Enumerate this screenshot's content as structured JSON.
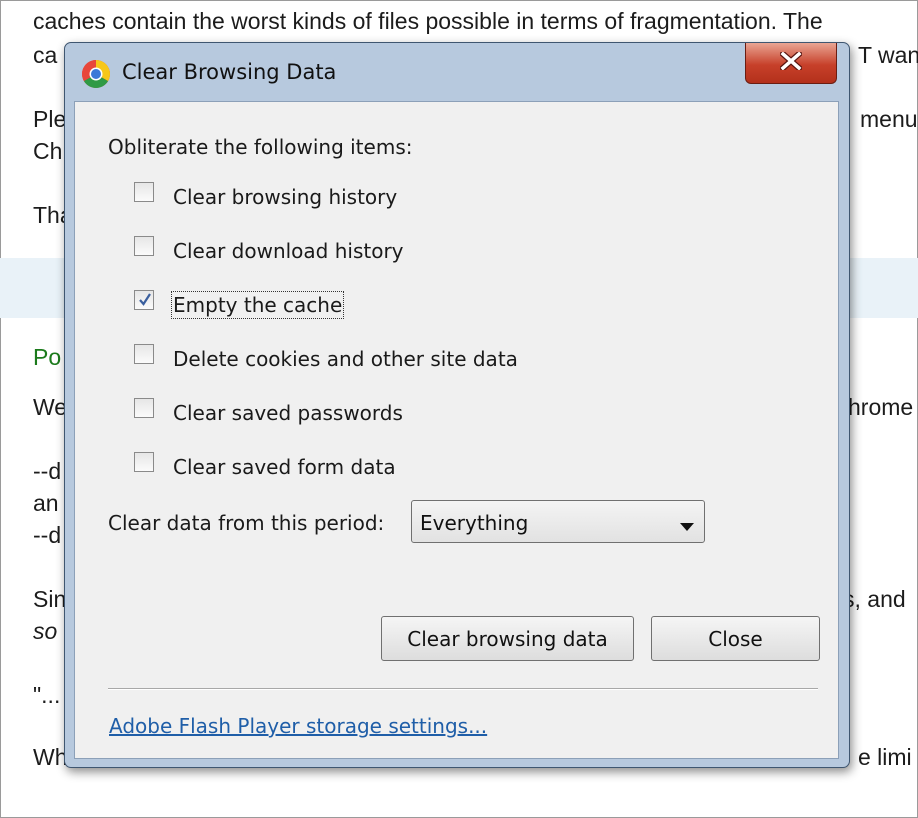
{
  "background": {
    "lines": [
      "caches contain the worst kinds of files possible in terms of fragmentation. The",
      "ca",
      "T want",
      "Ple",
      "menu",
      "Ch",
      "Tha",
      "Po",
      "We",
      "hrome",
      "--d",
      "an",
      "--d",
      "Sin",
      "s, and",
      "so",
      "\"...",
      "Wh",
      "e limi"
    ]
  },
  "dialog": {
    "title": "Clear Browsing Data",
    "close_icon": "close-icon",
    "app_icon": "chrome-icon",
    "heading": "Obliterate the following items:",
    "options": [
      {
        "label": "Clear browsing history",
        "checked": false
      },
      {
        "label": "Clear download history",
        "checked": false
      },
      {
        "label": "Empty the cache",
        "checked": true
      },
      {
        "label": "Delete cookies and other site data",
        "checked": false
      },
      {
        "label": "Clear saved passwords",
        "checked": false
      },
      {
        "label": "Clear saved form data",
        "checked": false
      }
    ],
    "period_label": "Clear data from this period:",
    "period_value": "Everything",
    "clear_button": "Clear browsing data",
    "close_button": "Close",
    "flash_link": "Adobe Flash Player storage settings..."
  },
  "colors": {
    "frame": "#b7c9de",
    "client": "#f0f0f0",
    "link": "#1f5ea8",
    "close_button": "#c7402a"
  }
}
